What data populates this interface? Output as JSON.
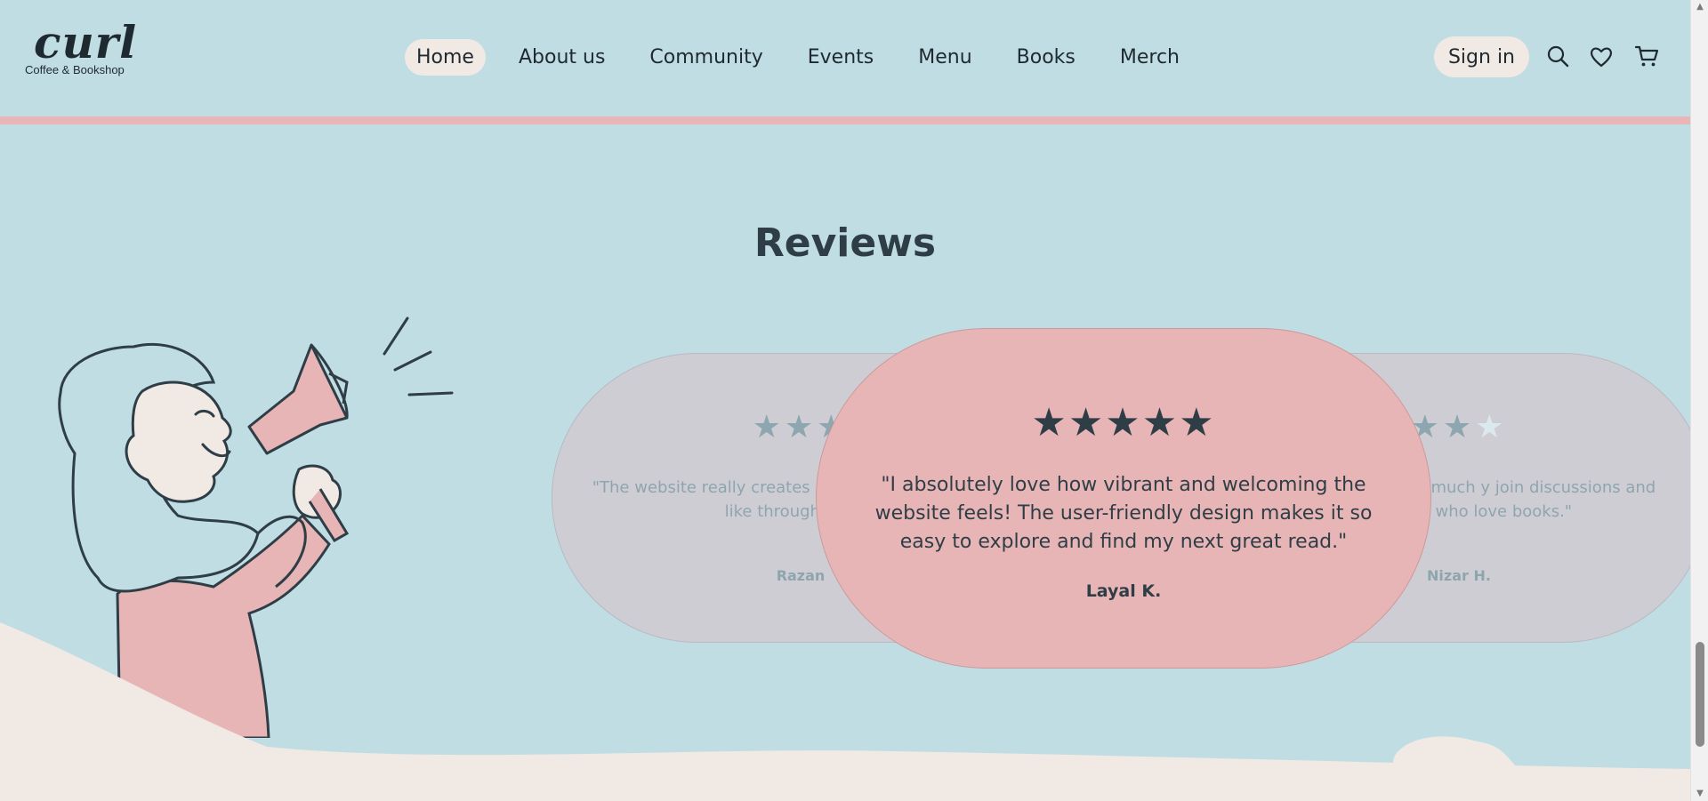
{
  "brand": {
    "name": "curl",
    "tagline": "Coffee & Bookshop"
  },
  "nav": {
    "items": [
      {
        "label": "Home",
        "active": true
      },
      {
        "label": "About us",
        "active": false
      },
      {
        "label": "Community",
        "active": false
      },
      {
        "label": "Events",
        "active": false
      },
      {
        "label": "Menu",
        "active": false
      },
      {
        "label": "Books",
        "active": false
      },
      {
        "label": "Merch",
        "active": false
      }
    ]
  },
  "header_actions": {
    "signin_label": "Sign in",
    "icons": [
      "search-icon",
      "heart-icon",
      "cart-icon"
    ]
  },
  "reviews": {
    "title": "Reviews",
    "cards": [
      {
        "position": "left",
        "rating": 3,
        "text": "\"The website really creates a sooo cute! I especially like through the bo",
        "reviewer": "Razan"
      },
      {
        "position": "center",
        "rating": 5,
        "text": "\"I absolutely love how vibrant and welcoming the website feels! The user-friendly design makes it so easy to explore and find my next great read.\"",
        "reviewer": "Layal K."
      },
      {
        "position": "right",
        "rating": 2,
        "text": "n the site make it so much y join discussions and share hers who love books.\"",
        "reviewer": "Nizar H."
      }
    ]
  },
  "colors": {
    "background": "#c0dde4",
    "accent_pink": "#e8b5b6",
    "cream": "#f1e9e4",
    "text_dark": "#2f3e46"
  }
}
